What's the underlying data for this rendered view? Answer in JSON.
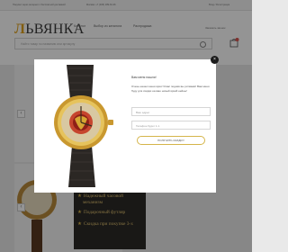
{
  "topbar": {
    "left_text": "Покупки через интернет с бесплатной доставкой",
    "phone_text": "Москва: +7 (495) 189-64-36",
    "right_text": "Вход / Регистрация"
  },
  "header": {
    "logo_first": "Л",
    "logo_rest": "ЬВЯНКА",
    "nav": [
      "Каталог",
      "Выбор из каталога",
      "Распродажа"
    ],
    "call_link": "Заказать звонок",
    "search_placeholder": "Найти товар по названию или артикулу",
    "cart_icon": "cart-icon",
    "search_icon": "search-icon"
  },
  "page": {
    "promo": [
      "Надежный часовой",
      "механизм",
      "Подарочный футляр",
      "Скидка при покупке 3-х"
    ]
  },
  "modal": {
    "title": "Вам меня нашли!",
    "text": "Очень нашел меня ярко! Я вас подняв вы ритмами! Вам меня буду для скидки на ваш новый яркий нейны!",
    "name_placeholder": "Ваш адрес",
    "phone_placeholder": "Телефон будет 1.1.",
    "button_label": "ПОЛУЧИТЬ СКИДКУ!",
    "close_glyph": "×"
  },
  "colors": {
    "accent": "#e0a11a",
    "button_border": "#d5b54a",
    "promo_bg": "#2c2a27"
  }
}
